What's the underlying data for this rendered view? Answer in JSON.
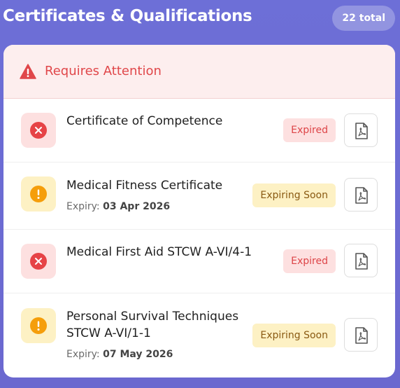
{
  "header": {
    "title": "Certificates & Qualifications",
    "total_badge": "22 total"
  },
  "attention": {
    "label": "Requires Attention",
    "icon": "warning-triangle-icon"
  },
  "certificates": [
    {
      "name": "Certificate of Competence",
      "status": "Expired",
      "status_type": "expired",
      "icon": "x-circle-icon",
      "expiry_label": "",
      "expiry_date": ""
    },
    {
      "name": "Medical Fitness Certificate",
      "status": "Expiring Soon",
      "status_type": "soon",
      "icon": "exclamation-circle-icon",
      "expiry_label": "Expiry:",
      "expiry_date": "03 Apr 2026"
    },
    {
      "name": "Medical First Aid STCW A-VI/4-1",
      "status": "Expired",
      "status_type": "expired",
      "icon": "x-circle-icon",
      "expiry_label": "",
      "expiry_date": ""
    },
    {
      "name": "Personal Survival Techniques STCW A-VI/1-1",
      "status": "Expiring Soon",
      "status_type": "soon",
      "icon": "exclamation-circle-icon",
      "expiry_label": "Expiry:",
      "expiry_date": "07 May 2026"
    }
  ],
  "colors": {
    "background": "#6d6fd7",
    "expired_text": "#dd4447",
    "expired_bg": "#fde0e0",
    "soon_text": "#8a5a12",
    "soon_bg": "#fdf1c4",
    "x_icon": "#e64346",
    "exclamation_icon": "#f59e0b"
  },
  "pdf_icon": "pdf-file-icon"
}
